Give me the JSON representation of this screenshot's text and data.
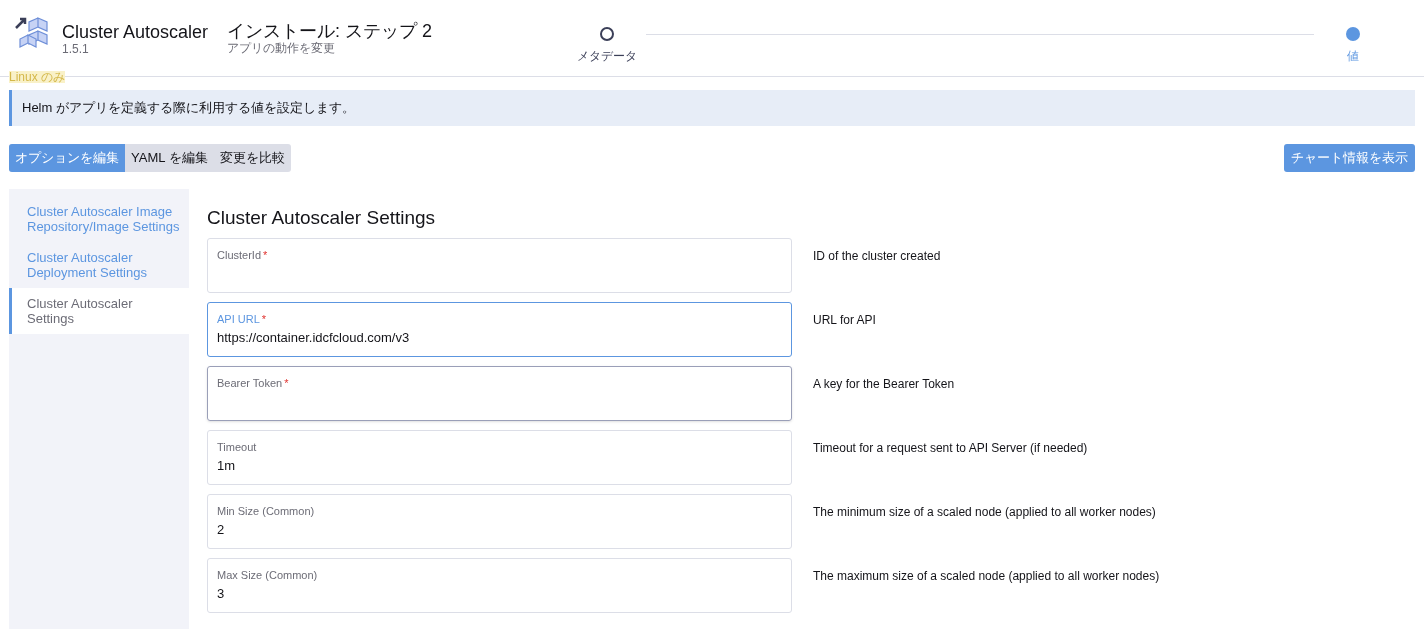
{
  "app": {
    "name": "Cluster Autoscaler",
    "version": "1.5.1"
  },
  "header": {
    "title": "インストール: ステップ 2",
    "subtitle": "アプリの動作を変更"
  },
  "steps": [
    {
      "label": "メタデータ",
      "selected": false
    },
    {
      "label": "値",
      "selected": true
    }
  ],
  "os_badge": "Linux のみ",
  "banner": "Helm がアプリを定義する際に利用する値を設定します。",
  "mode_tabs": [
    {
      "label": "オプションを編集",
      "selected": true
    },
    {
      "label": "YAML を編集",
      "selected": false
    },
    {
      "label": "変更を比較",
      "selected": false
    }
  ],
  "chart_info_button": "チャート情報を表示",
  "sidebar": {
    "items": [
      {
        "label": "Cluster Autoscaler Image Repository/Image Settings",
        "selected": false
      },
      {
        "label": "Cluster Autoscaler Deployment Settings",
        "selected": false
      },
      {
        "label": "Cluster Autoscaler Settings",
        "selected": true
      }
    ]
  },
  "section_title": "Cluster Autoscaler Settings",
  "fields": [
    {
      "label": "ClusterId",
      "required_mark": "*",
      "focused": false,
      "hovered": false,
      "description": "ID of the cluster created"
    },
    {
      "label": "API URL",
      "required_mark": "*",
      "value": "https://container.idcfcloud.com/v3",
      "focused": true,
      "hovered": false,
      "description": "URL for API"
    },
    {
      "label": "Bearer Token",
      "required_mark": "*",
      "focused": false,
      "hovered": true,
      "description": "A key for the Bearer Token"
    },
    {
      "label": "Timeout",
      "value": "1m",
      "focused": false,
      "hovered": false,
      "description": "Timeout for a request sent to API Server (if needed)"
    },
    {
      "label": "Min Size (Common)",
      "value": "2",
      "focused": false,
      "hovered": false,
      "description": "The minimum size of a scaled node (applied to all worker nodes)"
    },
    {
      "label": "Max Size (Common)",
      "value": "3",
      "focused": false,
      "hovered": false,
      "description": "The maximum size of a scaled node (applied to all worker nodes)"
    }
  ]
}
